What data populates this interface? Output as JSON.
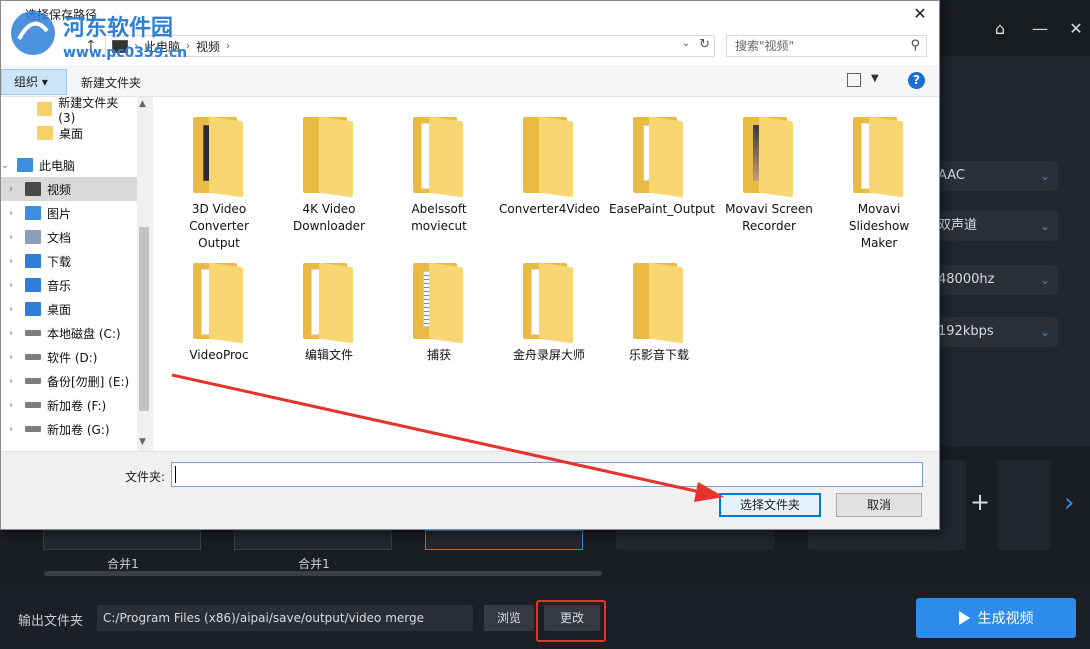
{
  "dialog": {
    "title": "选择保存路径",
    "close_glyph": "✕",
    "watermark": {
      "site_name": "河东软件园",
      "site_url": "www.pc0359.cn"
    },
    "address": {
      "crumbs": [
        "此电脑",
        "视频"
      ]
    },
    "search_placeholder": "搜索\"视频\"",
    "toolbar": {
      "organize": "组织 ▾",
      "new_folder": "新建文件夹"
    },
    "nav": [
      {
        "label": "新建文件夹 (3)",
        "icon": "folder-icon"
      },
      {
        "label": "桌面",
        "icon": "folder-icon"
      },
      {
        "label": "此电脑",
        "icon": "computer-icon"
      },
      {
        "label": "视频",
        "icon": "video-icon",
        "selected": true
      },
      {
        "label": "图片",
        "icon": "picture-icon"
      },
      {
        "label": "文档",
        "icon": "document-icon"
      },
      {
        "label": "下载",
        "icon": "download-icon"
      },
      {
        "label": "音乐",
        "icon": "music-icon"
      },
      {
        "label": "桌面",
        "icon": "desktop-icon"
      },
      {
        "label": "本地磁盘 (C:)",
        "icon": "drive-icon"
      },
      {
        "label": "软件 (D:)",
        "icon": "drive-icon"
      },
      {
        "label": "备份[勿删] (E:)",
        "icon": "drive-icon"
      },
      {
        "label": "新加卷 (F:)",
        "icon": "drive-icon"
      },
      {
        "label": "新加卷 (G:)",
        "icon": "drive-icon"
      }
    ],
    "folders": [
      {
        "name": "3D Video Converter Output",
        "art": "video-thumbnail"
      },
      {
        "name": "4K Video Downloader",
        "art": "plain"
      },
      {
        "name": "Abelssoft moviecut",
        "art": "document"
      },
      {
        "name": "Converter4Video",
        "art": "plain"
      },
      {
        "name": "EasePaint_Output",
        "art": "film"
      },
      {
        "name": "Movavi Screen Recorder",
        "art": "photo"
      },
      {
        "name": "Movavi Slideshow Maker",
        "art": "document"
      },
      {
        "name": "VideoProc",
        "art": "paper"
      },
      {
        "name": "编辑文件",
        "art": "paper"
      },
      {
        "name": "捕获",
        "art": "text-page"
      },
      {
        "name": "金舟录屏大师",
        "art": "paper"
      },
      {
        "name": "乐影音下载",
        "art": "plain"
      }
    ],
    "filename_label": "文件夹:",
    "select_button": "选择文件夹",
    "cancel_button": "取消"
  },
  "app": {
    "dropdowns": [
      "AAC",
      "双声道",
      "48000hz",
      "192kbps"
    ],
    "clips": [
      "合并1",
      "合并1"
    ],
    "output_label": "输出文件夹",
    "output_path": "C:/Program Files (x86)/aipai/save/output/video merge",
    "browse_button": "浏览",
    "change_button": "更改",
    "generate_button": "生成视频",
    "add_glyph": "+",
    "next_glyph": "›"
  },
  "colors": {
    "accent": "#2d8ceb",
    "highlight": "#e8322c",
    "folder": "#f8d773"
  }
}
